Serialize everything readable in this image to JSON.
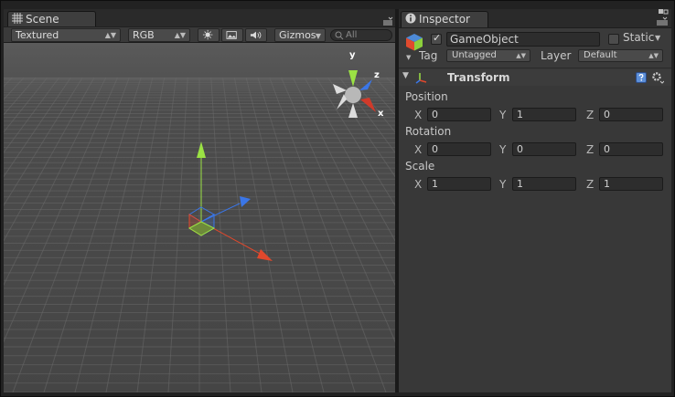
{
  "scene": {
    "tab_label": "Scene",
    "toolbar": {
      "render_mode": "Textured",
      "color_mode": "RGB",
      "gizmos_label": "Gizmos",
      "search_placeholder": "All"
    },
    "gizmo_axes": {
      "x": "x",
      "y": "y",
      "z": "z"
    }
  },
  "inspector": {
    "tab_label": "Inspector",
    "game_object": {
      "name": "GameObject",
      "static_label": "Static",
      "tag_label": "Tag",
      "tag_value": "Untagged",
      "layer_label": "Layer",
      "layer_value": "Default"
    },
    "transform": {
      "title": "Transform",
      "position_label": "Position",
      "rotation_label": "Rotation",
      "scale_label": "Scale",
      "axis_x": "X",
      "axis_y": "Y",
      "axis_z": "Z",
      "position": {
        "x": "0",
        "y": "1",
        "z": "0"
      },
      "rotation": {
        "x": "0",
        "y": "0",
        "z": "0"
      },
      "scale": {
        "x": "1",
        "y": "1",
        "z": "1"
      }
    }
  },
  "colors": {
    "axis_x": "#e0482c",
    "axis_y": "#9be244",
    "axis_z": "#3a76e8",
    "viewport_bg": "#4a4a4a",
    "panel_bg": "#383838"
  }
}
